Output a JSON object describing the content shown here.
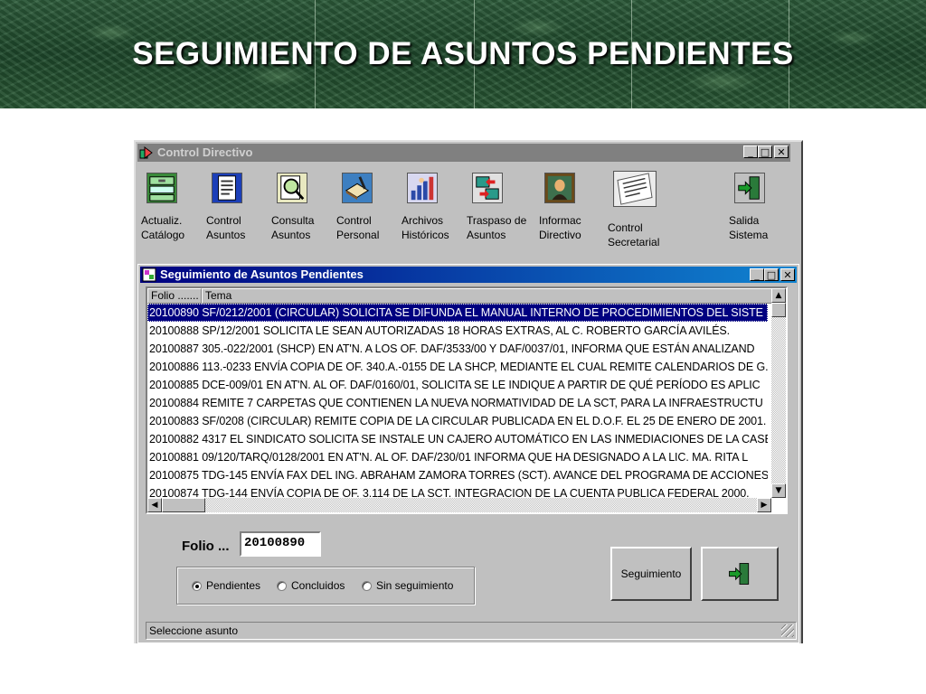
{
  "slide": {
    "title": "SEGUIMIENTO DE ASUNTOS PENDIENTES"
  },
  "main_window": {
    "title": "Control Directivo",
    "controls": {
      "minimize": "_",
      "maximize": "□",
      "close": "✕"
    },
    "toolbar": [
      {
        "icon": "catalog-icon",
        "label": "Actualiz.\nCatálogo"
      },
      {
        "icon": "document-icon",
        "label": "Control\nAsuntos"
      },
      {
        "icon": "magnifier-icon",
        "label": "Consulta\nAsuntos"
      },
      {
        "icon": "book-icon",
        "label": "Control\nPersonal"
      },
      {
        "icon": "archive-icon",
        "label": "Archivos\nHistóricos"
      },
      {
        "icon": "transfer-icon",
        "label": "Traspaso de\nAsuntos"
      },
      {
        "icon": "portrait-icon",
        "label": "Informac\nDirectivo"
      },
      {
        "icon": "notepad-icon",
        "label": "Control\nSecretarial"
      },
      {
        "icon": "exit-icon",
        "label": "Salida\nSistema"
      }
    ]
  },
  "child_window": {
    "title": "Seguimiento de Asuntos Pendientes",
    "columns": [
      "Folio .......",
      "Tema"
    ],
    "rows": [
      "20100890 SF/0212/2001 (CIRCULAR) SOLICITA SE DIFUNDA EL MANUAL INTERNO DE PROCEDIMIENTOS DEL SISTE",
      "20100888 SP/12/2001 SOLICITA LE SEAN AUTORIZADAS 18 HORAS EXTRAS, AL C. ROBERTO GARCÍA AVILÉS.",
      "20100887 305.-022/2001 (SHCP) EN AT'N. A LOS OF. DAF/3533/00 Y DAF/0037/01, INFORMA QUE ESTÁN ANALIZAND",
      "20100886 113.-0233 ENVÍA COPIA DE OF. 340.A.-0155 DE LA SHCP, MEDIANTE EL CUAL REMITE CALENDARIOS DE G.",
      "20100885 DCE-009/01 EN AT'N. AL OF. DAF/0160/01, SOLICITA SE LE INDIQUE A PARTIR DE QUÉ PERÍODO ES APLIC",
      "20100884 REMITE 7 CARPETAS QUE CONTIENEN LA NUEVA NORMATIVIDAD DE LA SCT, PARA LA INFRAESTRUCTU",
      "20100883 SF/0208 (CIRCULAR) REMITE COPIA DE LA CIRCULAR PUBLICADA EN EL D.O.F. EL 25 DE ENERO DE 2001.",
      "20100882 4317 EL SINDICATO SOLICITA SE INSTALE UN CAJERO AUTOMÁTICO EN LAS INMEDIACIONES DE LA CASE",
      "20100881 09/120/TARQ/0128/2001 EN AT'N. AL OF. DAF/230/01 INFORMA QUE HA DESIGNADO A LA LIC. MA. RITA L",
      "20100875 TDG-145 ENVÍA FAX DEL ING. ABRAHAM ZAMORA TORRES (SCT). AVANCE DEL PROGRAMA DE ACCIONES",
      "20100874 TDG-144 ENVÍA COPIA DE OF. 3.114 DE LA SCT. INTEGRACION DE LA CUENTA PUBLICA FEDERAL 2000."
    ],
    "selected_row": 0,
    "folio_label": "Folio ...",
    "folio_value": "20100890",
    "filters": [
      {
        "label": "Pendientes",
        "checked": true
      },
      {
        "label": "Concluidos",
        "checked": false
      },
      {
        "label": "Sin seguimiento",
        "checked": false
      }
    ],
    "seguimiento_button": "Seguimiento",
    "status_text": "Seleccione asunto"
  }
}
